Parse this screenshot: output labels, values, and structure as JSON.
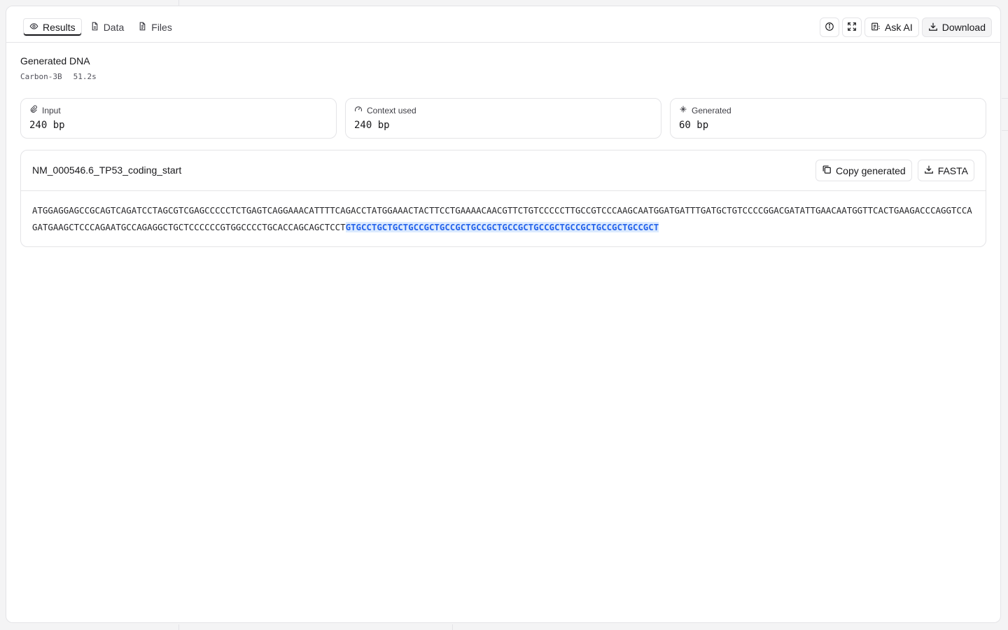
{
  "tabs": [
    {
      "label": "Results",
      "icon": "eye-icon"
    },
    {
      "label": "Data",
      "icon": "file-icon"
    },
    {
      "label": "Files",
      "icon": "file-text-icon"
    }
  ],
  "actions": {
    "ask_ai": "Ask AI",
    "download": "Download"
  },
  "header": {
    "title": "Generated DNA",
    "model": "Carbon-3B",
    "duration": "51.2s"
  },
  "stats": [
    {
      "label": "Input",
      "value": "240 bp"
    },
    {
      "label": "Context used",
      "value": "240 bp"
    },
    {
      "label": "Generated",
      "value": "60 bp"
    }
  ],
  "sequence": {
    "name": "NM_000546.6_TP53_coding_start",
    "copy_label": "Copy generated",
    "fasta_label": "FASTA",
    "input": "ATGGAGGAGCCGCAGTCAGATCCTAGCGTCGAGCCCCCTCTGAGTCAGGAAACATTTTCAGACCTATGGAAACTACTTCCTGAAAACAACGTTCTGTCCCCCTTGCCGTCCCAAGCAATGGATGATTTGATGCTGTCCCCGGACGATATTGAACAATGGTTCACTGAAGACCCAGGTCCAGATGAAGCTCCCAGAATGCCAGAGGCTGCTCCCCCCGTGGCCCCTGCACCAGCAGCTCCT",
    "generated": "GTGCCTGCTGCTGCCGCTGCCGCTGCCGCTGCCGCTGCCGCTGCCGCTGCCGCTGCCGCT"
  },
  "colors": {
    "accent": "#2563eb",
    "highlight": "#dbeafe",
    "border": "#e4e4e7"
  }
}
